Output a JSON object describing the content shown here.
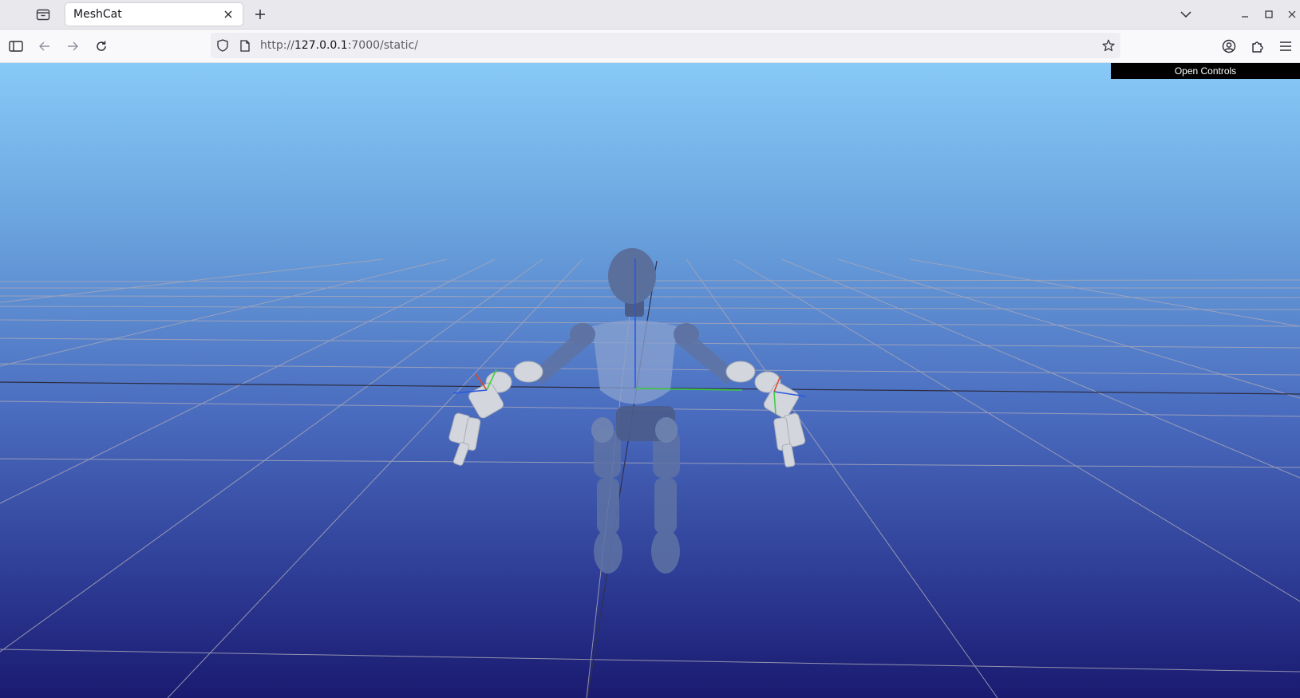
{
  "browser": {
    "tab": {
      "title": "MeshCat"
    },
    "url": {
      "prefix": "http://",
      "host": "127.0.0.1",
      "rest": ":7000/static/"
    },
    "icons": {
      "tab_list": "tab-list-icon",
      "close_tab": "close-icon",
      "new_tab": "plus-icon",
      "tabs_overflow": "chevron-down-icon",
      "sidebar": "sidebar-icon",
      "back": "back-arrow-icon",
      "forward": "forward-arrow-icon",
      "reload": "reload-icon",
      "shield": "shield-icon",
      "page_info": "page-icon",
      "bookmark": "star-icon",
      "account": "account-icon",
      "extensions": "puzzle-icon",
      "menu": "hamburger-menu-icon"
    }
  },
  "meshcat": {
    "open_controls_label": "Open Controls",
    "scene": {
      "background_top": "#87c9f7",
      "background_bottom": "#1a1a70",
      "grid_color": "#a6a6b8",
      "robot_color": "#6b7fa8",
      "hands_color": "#cfd2d8",
      "axis_x_color": "#e04a2a",
      "axis_y_color": "#3fcf3f",
      "axis_z_color": "#2a58e0"
    }
  }
}
